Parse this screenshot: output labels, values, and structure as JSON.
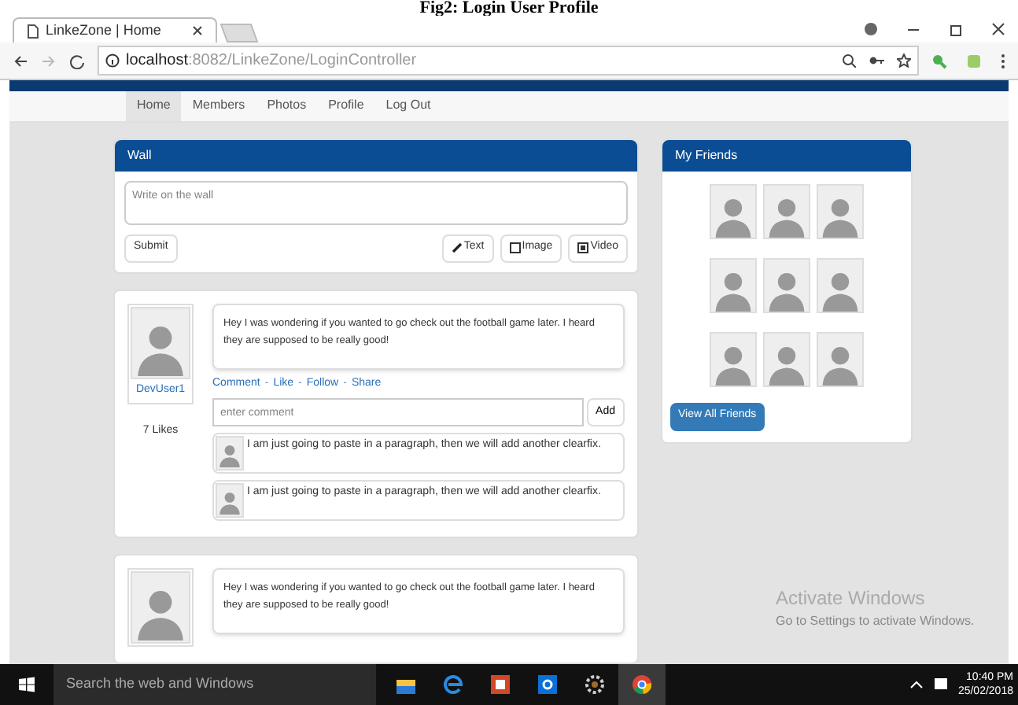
{
  "caption": "Fig2: Login User Profile",
  "browser": {
    "tab_title": "LinkeZone | Home",
    "url_host": "localhost",
    "url_path": ":8082/LinkeZone/LoginController"
  },
  "nav": [
    {
      "label": "Home",
      "selected": true
    },
    {
      "label": "Members",
      "selected": false
    },
    {
      "label": "Photos",
      "selected": false
    },
    {
      "label": "Profile",
      "selected": false
    },
    {
      "label": "Log Out",
      "selected": false
    }
  ],
  "wall": {
    "title": "Wall",
    "placeholder": "Write on the wall",
    "submit": "Submit",
    "buttons": [
      "Text",
      "Image",
      "Video"
    ]
  },
  "posts": [
    {
      "user": "DevUser1",
      "likes": "7 Likes",
      "text": "Hey I was wondering if you wanted to go check out the football game later. I heard they are supposed to be really good!",
      "actions": [
        {
          "kind": "link",
          "text": "Comment"
        },
        {
          "kind": "separator",
          "text": "-"
        },
        {
          "kind": "link",
          "text": "Like"
        },
        {
          "kind": "separator",
          "text": "-"
        },
        {
          "kind": "link",
          "text": "Follow"
        },
        {
          "kind": "separator",
          "text": "-"
        },
        {
          "kind": "link",
          "text": "Share"
        }
      ],
      "comment_placeholder": "enter comment",
      "add": "Add",
      "comments": [
        "I am just going to paste in a paragraph, then we will add another clearfix.",
        "I am just going to paste in a paragraph, then we will add another clearfix."
      ]
    },
    {
      "text": "Hey I was wondering if you wanted to go check out the football game later. I heard they are supposed to be really good!"
    }
  ],
  "friends": {
    "title": "My Friends",
    "avatars": [
      {
        "kind": "avatar"
      },
      {
        "kind": "avatar"
      },
      {
        "kind": "avatar"
      },
      {
        "kind": "avatar"
      },
      {
        "kind": "avatar"
      },
      {
        "kind": "avatar"
      },
      {
        "kind": "avatar"
      },
      {
        "kind": "avatar"
      },
      {
        "kind": "avatar"
      }
    ],
    "button": "View All Friends"
  },
  "activation": {
    "title": "Activate Windows",
    "subtitle": "Go to Settings to activate Windows."
  },
  "taskbar": {
    "search": "Search the web and Windows",
    "time": "10:40 PM",
    "date": "25/02/2018"
  }
}
